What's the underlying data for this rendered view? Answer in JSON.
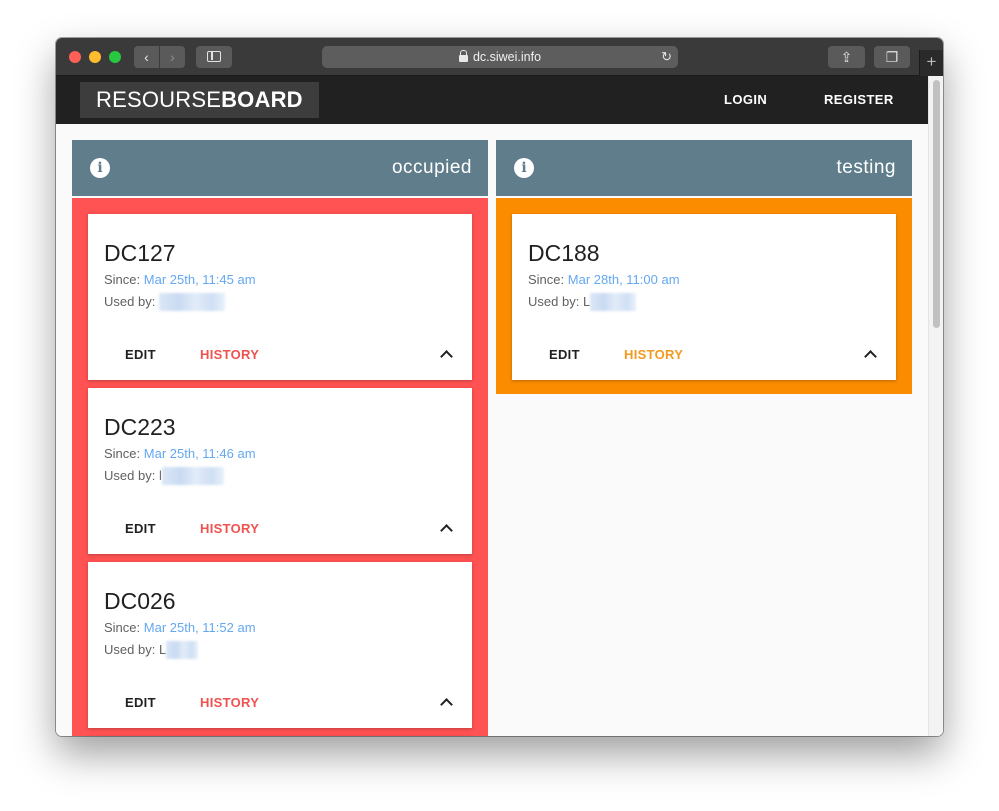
{
  "browser": {
    "url": "dc.siwei.info",
    "back_glyph": "‹",
    "forward_glyph": "›",
    "reload_glyph": "↻",
    "share_glyph": "⇪",
    "tabs_glyph": "❐",
    "newtab_glyph": "+"
  },
  "app": {
    "brand_light": "RESOURSE",
    "brand_bold": "BOARD",
    "login": "LOGIN",
    "register": "REGISTER"
  },
  "colors": {
    "header": "#607d8b",
    "occupied": "#ff5252",
    "testing": "#fb8c00",
    "appbar": "#212121",
    "time_link": "#64a8f0"
  },
  "columns": [
    {
      "title": "occupied",
      "icon": "info-icon",
      "cards": [
        {
          "name": "DC127",
          "since_label": "Since:",
          "since": "Mar 25th, 11:45 am",
          "user_label": "Used by:",
          "edit": "EDIT",
          "history": "HISTORY"
        },
        {
          "name": "DC223",
          "since_label": "Since:",
          "since": "Mar 25th, 11:46 am",
          "user_label": "Used by:",
          "user_initial": "l",
          "edit": "EDIT",
          "history": "HISTORY"
        },
        {
          "name": "DC026",
          "since_label": "Since:",
          "since": "Mar 25th, 11:52 am",
          "user_label": "Used by:",
          "user_initial": "L",
          "edit": "EDIT",
          "history": "HISTORY"
        }
      ]
    },
    {
      "title": "testing",
      "icon": "info-icon",
      "cards": [
        {
          "name": "DC188",
          "since_label": "Since:",
          "since": "Mar 28th, 11:00 am",
          "user_label": "Used by:",
          "user_initial": "L",
          "edit": "EDIT",
          "history": "HISTORY"
        }
      ]
    }
  ]
}
